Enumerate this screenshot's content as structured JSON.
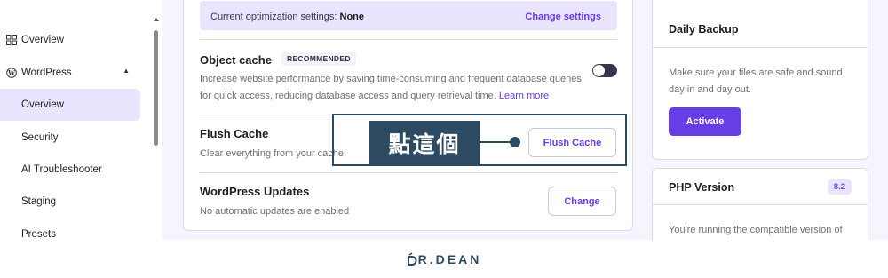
{
  "sidebar": {
    "items": [
      {
        "label": "Overview",
        "icon": "grid-icon"
      },
      {
        "label": "WordPress",
        "icon": "wordpress-icon"
      },
      {
        "label": "Overview"
      },
      {
        "label": "Security"
      },
      {
        "label": "AI Troubleshooter"
      },
      {
        "label": "Staging"
      },
      {
        "label": "Presets"
      }
    ]
  },
  "main": {
    "optimization": {
      "prefix": "Current optimization settings: ",
      "value": "None",
      "link": "Change settings"
    },
    "object_cache": {
      "title": "Object cache",
      "badge": "RECOMMENDED",
      "desc_line1": "Increase website performance by saving time-consuming and frequent database queries",
      "desc_line2": "for quick access, reducing database access and query retrieval time. ",
      "learn_more": "Learn more",
      "toggle_on": false
    },
    "flush_cache": {
      "title": "Flush Cache",
      "desc": "Clear everything from your cache.",
      "button": "Flush Cache"
    },
    "wp_updates": {
      "title": "WordPress Updates",
      "desc": "No automatic updates are enabled",
      "button": "Change"
    }
  },
  "callout": {
    "label": "點這個"
  },
  "right": {
    "backup": {
      "title": "Daily Backup",
      "desc": "Make sure your files are safe and sound, day in and day out.",
      "button": "Activate"
    },
    "php": {
      "title": "PHP Version",
      "version": "8.2",
      "desc": "You're running the compatible version of"
    }
  },
  "watermark": {
    "text": "R.DEAN"
  },
  "colors": {
    "accent": "#673de6",
    "accent_light": "#ebe4ff",
    "callout": "#2d4a63"
  }
}
